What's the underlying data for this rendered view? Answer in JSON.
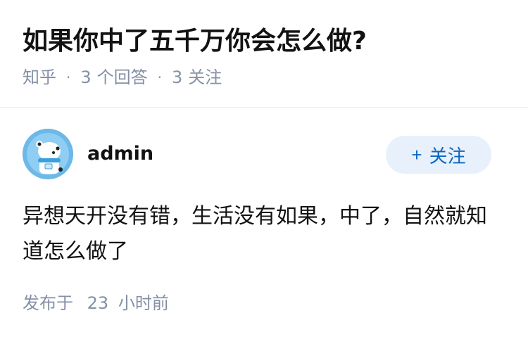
{
  "question": {
    "title": "如果你中了五千万你会怎么做?",
    "source": "知乎",
    "separator": "·",
    "answer_count": "3",
    "answer_label": "个回答",
    "follower_count": "3",
    "follower_label": "关注"
  },
  "answer": {
    "author": "admin",
    "follow_icon": "+",
    "follow_label": "关注",
    "body": "异想天开没有错，生活没有如果，中了，自然就知道怎么做了",
    "time_prefix": "发布于",
    "time_value": "23",
    "time_unit": "小时前"
  },
  "colors": {
    "accent": "#0a66c2",
    "accent_bg": "#e8f0fb",
    "meta_text": "#8590a6",
    "avatar_bg": "#6cb8e8"
  },
  "icons": {
    "avatar": "bear-mascot-avatar"
  }
}
